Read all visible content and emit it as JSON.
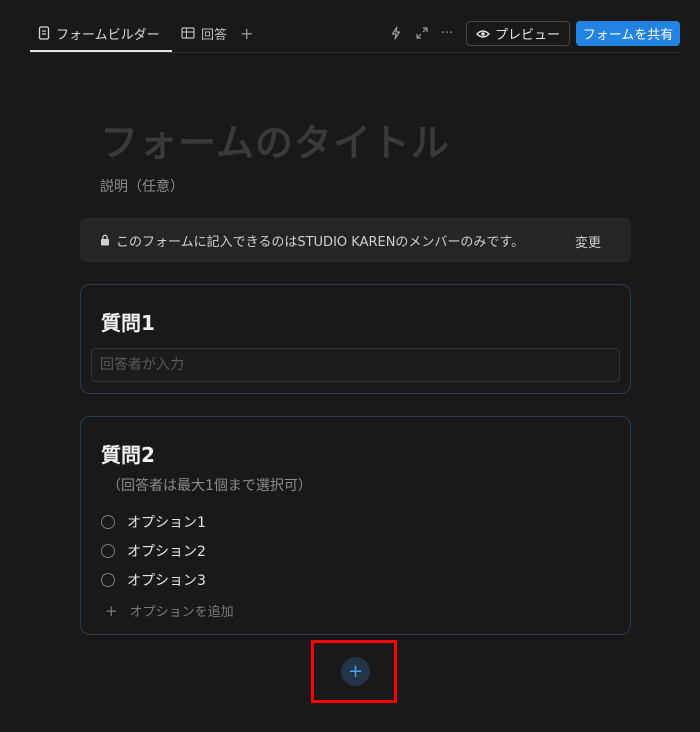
{
  "tabs": {
    "builder_label": "フォームビルダー",
    "responses_label": "回答",
    "add_label": "+"
  },
  "toolbar": {
    "more_label": "···",
    "preview_label": "プレビュー",
    "share_label": "フォームを共有"
  },
  "form": {
    "title_placeholder": "フォームのタイトル",
    "description_placeholder": "説明（任意）"
  },
  "notice": {
    "text": "このフォームに記入できるのはSTUDIO KARENのメンバーのみです。",
    "change_label": "変更"
  },
  "questions": [
    {
      "title": "質問1",
      "input_placeholder": "回答者が入力"
    },
    {
      "title": "質問2",
      "hint": "（回答者は最大1個まで選択可）",
      "options": [
        "オプション1",
        "オプション2",
        "オプション3"
      ],
      "add_option_label": "オプションを追加"
    }
  ],
  "add_question": {
    "label": "+"
  },
  "colors": {
    "background": "#191919",
    "accent": "#2383e2",
    "card_border": "#2b3b4f",
    "highlight": "#ff0000"
  }
}
